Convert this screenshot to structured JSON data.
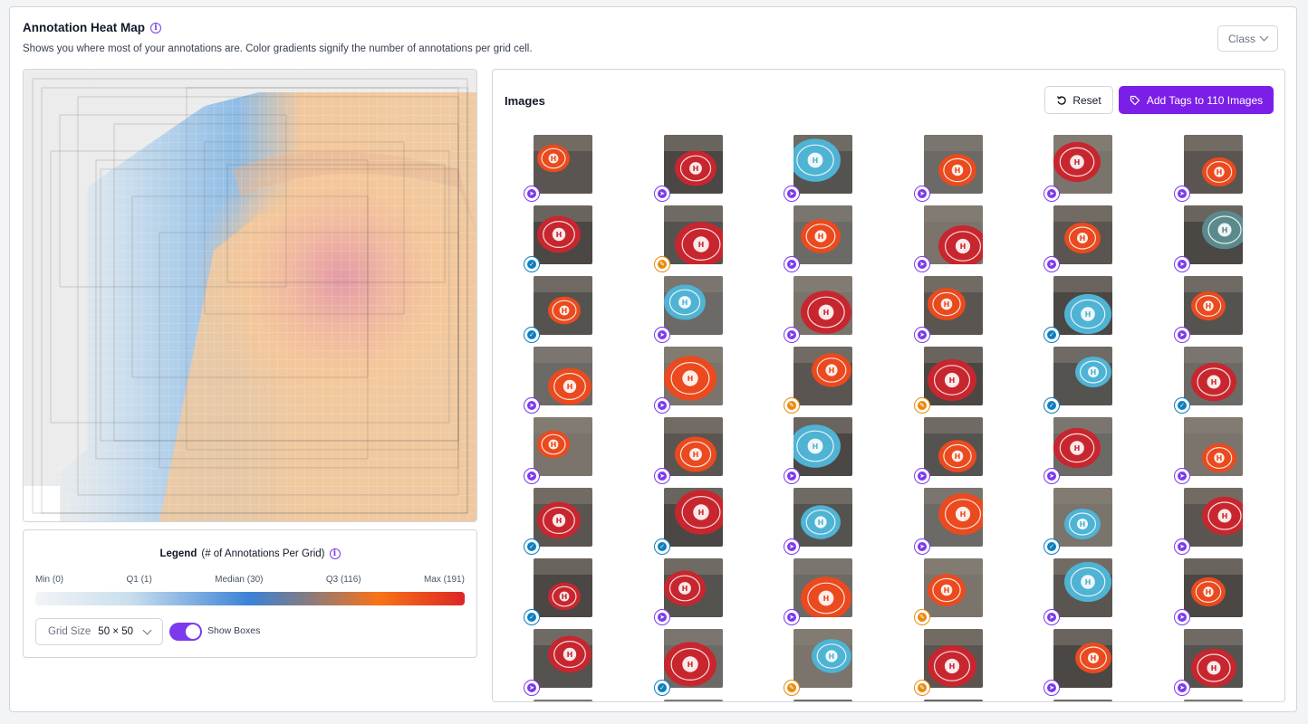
{
  "header": {
    "title": "Annotation Heat Map",
    "subtitle": "Shows you where most of your annotations are. Color gradients signify the number of annotations per grid cell.",
    "class_dropdown": "Class"
  },
  "legend": {
    "title_bold": "Legend",
    "title_rest": "(# of Annotations Per Grid)",
    "quartiles": [
      "Min (0)",
      "Q1 (1)",
      "Median (30)",
      "Q3 (116)",
      "Max (191)"
    ],
    "grid_size_label": "Grid Size",
    "grid_size_value": "50 × 50",
    "show_boxes_label": "Show Boxes",
    "show_boxes_on": true
  },
  "images": {
    "title": "Images",
    "reset_label": "Reset",
    "add_tags_label": "Add Tags to 110 Images",
    "badge_colors": {
      "run": "#7c3aed",
      "shield": "#0e7fc0",
      "pencil": "#ea8a0c"
    },
    "thumbnails": [
      [
        "run",
        "orange"
      ],
      [
        "run",
        "red"
      ],
      [
        "run",
        "cyan"
      ],
      [
        "run",
        "orange"
      ],
      [
        "run",
        "red"
      ],
      [
        "run",
        "orange"
      ],
      [
        "shield",
        "red"
      ],
      [
        "pencil",
        "red"
      ],
      [
        "run",
        "orange"
      ],
      [
        "run",
        "red"
      ],
      [
        "run",
        "orange"
      ],
      [
        "run",
        "teal"
      ],
      [
        "shield",
        "orange"
      ],
      [
        "run",
        "cyan"
      ],
      [
        "run",
        "red"
      ],
      [
        "run",
        "orange"
      ],
      [
        "shield",
        "cyan"
      ],
      [
        "run",
        "orange"
      ],
      [
        "run",
        "orange"
      ],
      [
        "run",
        "orange"
      ],
      [
        "pencil",
        "orange"
      ],
      [
        "pencil",
        "red"
      ],
      [
        "shield",
        "cyan"
      ],
      [
        "shield",
        "red"
      ],
      [
        "run",
        "orange"
      ],
      [
        "run",
        "orange"
      ],
      [
        "run",
        "cyan"
      ],
      [
        "run",
        "orange"
      ],
      [
        "run",
        "red"
      ],
      [
        "run",
        "orange"
      ],
      [
        "shield",
        "red"
      ],
      [
        "shield",
        "red"
      ],
      [
        "run",
        "cyan"
      ],
      [
        "run",
        "orange"
      ],
      [
        "shield",
        "cyan"
      ],
      [
        "run",
        "red"
      ],
      [
        "shield",
        "red"
      ],
      [
        "run",
        "red"
      ],
      [
        "run",
        "orange"
      ],
      [
        "pencil",
        "orange"
      ],
      [
        "run",
        "cyan"
      ],
      [
        "run",
        "orange"
      ],
      [
        "run",
        "red"
      ],
      [
        "shield",
        "red"
      ],
      [
        "pencil",
        "cyan"
      ],
      [
        "pencil",
        "red"
      ],
      [
        "run",
        "orange"
      ],
      [
        "run",
        "red"
      ]
    ]
  }
}
